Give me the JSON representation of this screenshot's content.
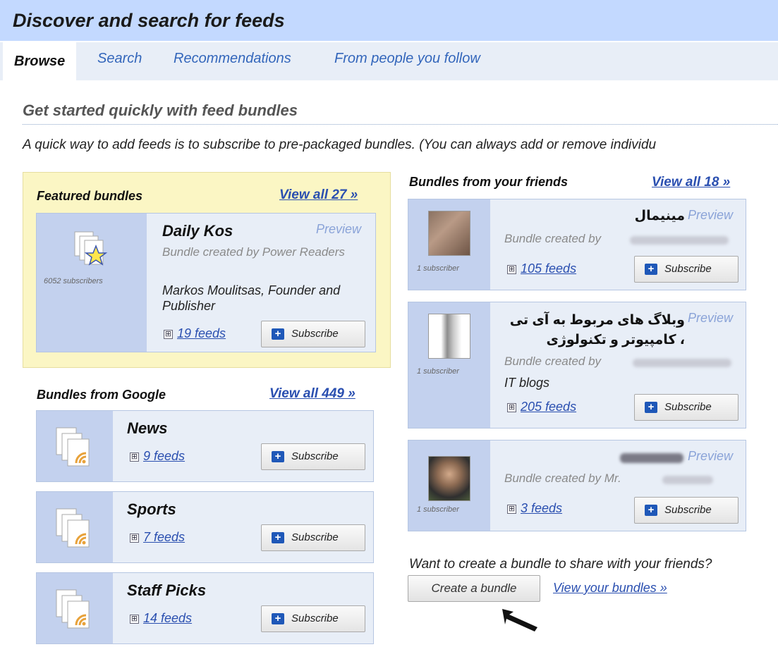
{
  "header": {
    "title": "Discover and search for feeds"
  },
  "tabs": [
    {
      "label": "Browse",
      "active": true
    },
    {
      "label": "Search"
    },
    {
      "label": "Recommendations"
    },
    {
      "label": "From people you follow"
    }
  ],
  "section": {
    "heading": "Get started quickly with feed bundles",
    "intro": "A quick way to add feeds is to subscribe to pre-packaged bundles. (You can always add or remove individu"
  },
  "common": {
    "subscribe_label": "Subscribe",
    "preview_label": "Preview",
    "expand_glyph": "⊞"
  },
  "featured": {
    "title": "Featured bundles",
    "view_all": "View all 27 »",
    "bundle": {
      "name": "Daily Kos",
      "created_by": "Bundle created by Power Readers",
      "description": "Markos Moulitsas, Founder and Publisher",
      "subscribers": "6052 subscribers",
      "feeds": "19 feeds"
    }
  },
  "google": {
    "title": "Bundles from Google",
    "view_all": "View all 449 »",
    "bundles": [
      {
        "name": "News",
        "feeds": "9 feeds"
      },
      {
        "name": "Sports",
        "feeds": "7 feeds"
      },
      {
        "name": "Staff Picks",
        "feeds": "14 feeds"
      }
    ]
  },
  "friends": {
    "title": "Bundles from your friends",
    "view_all": "View all 18 »",
    "bundles": [
      {
        "name": "مینیمال",
        "created_by": "Bundle created by",
        "subscribers": "1 subscriber",
        "feeds": "105 feeds"
      },
      {
        "name_line1": "وبلاگ های مربوط به آی تی",
        "name_line2": "، کامپیوتر و تکنولوژی",
        "created_by": "Bundle created by",
        "description": "IT blogs",
        "subscribers": "1 subscriber",
        "feeds": "205 feeds"
      },
      {
        "created_by": "Bundle created by Mr.",
        "subscribers": "1 subscriber",
        "feeds": "3 feeds"
      }
    ]
  },
  "create": {
    "prompt": "Want to create a bundle to share with your friends?",
    "button": "Create a bundle",
    "view_link": "View your bundles »"
  }
}
